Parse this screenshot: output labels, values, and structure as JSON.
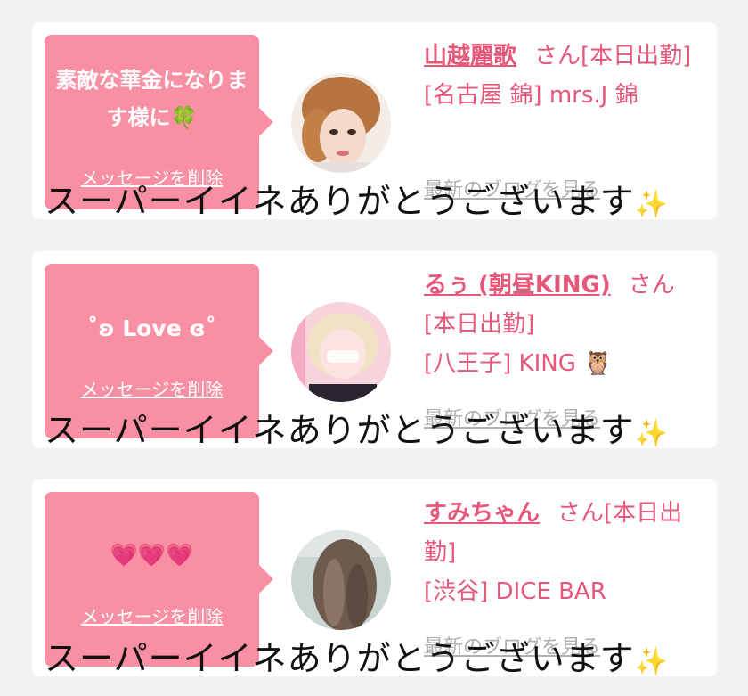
{
  "cards": [
    {
      "message": "素敵な華金になります様に🍀",
      "delete_label": "メッセージを削除",
      "name": "山越麗歌",
      "honorific": "さん[本日出勤]",
      "location": "[名古屋 錦] mrs.J 錦",
      "latest_link": "最新のブログを見る",
      "caption": "スーパーイイネありがとうございます",
      "caption_emoji": "✨"
    },
    {
      "message": "˚ʚ Love ɞ˚",
      "delete_label": "メッセージを削除",
      "name": "るぅ (朝昼KING)",
      "honorific": "さん",
      "status": "[本日出勤]",
      "location": "[八王子] KING 🦉",
      "latest_link": "最新のブログを見る",
      "caption": "スーパーイイネありがとうございます",
      "caption_emoji": "✨"
    },
    {
      "message": "💗💗💗",
      "delete_label": "メッセージを削除",
      "name": "すみちゃん",
      "honorific": "さん[本日出勤]",
      "location": "[渋谷] DICE BAR",
      "latest_link": "最新のブログを見る",
      "caption": "スーパーイイネありがとうございます",
      "caption_emoji": "✨"
    }
  ]
}
